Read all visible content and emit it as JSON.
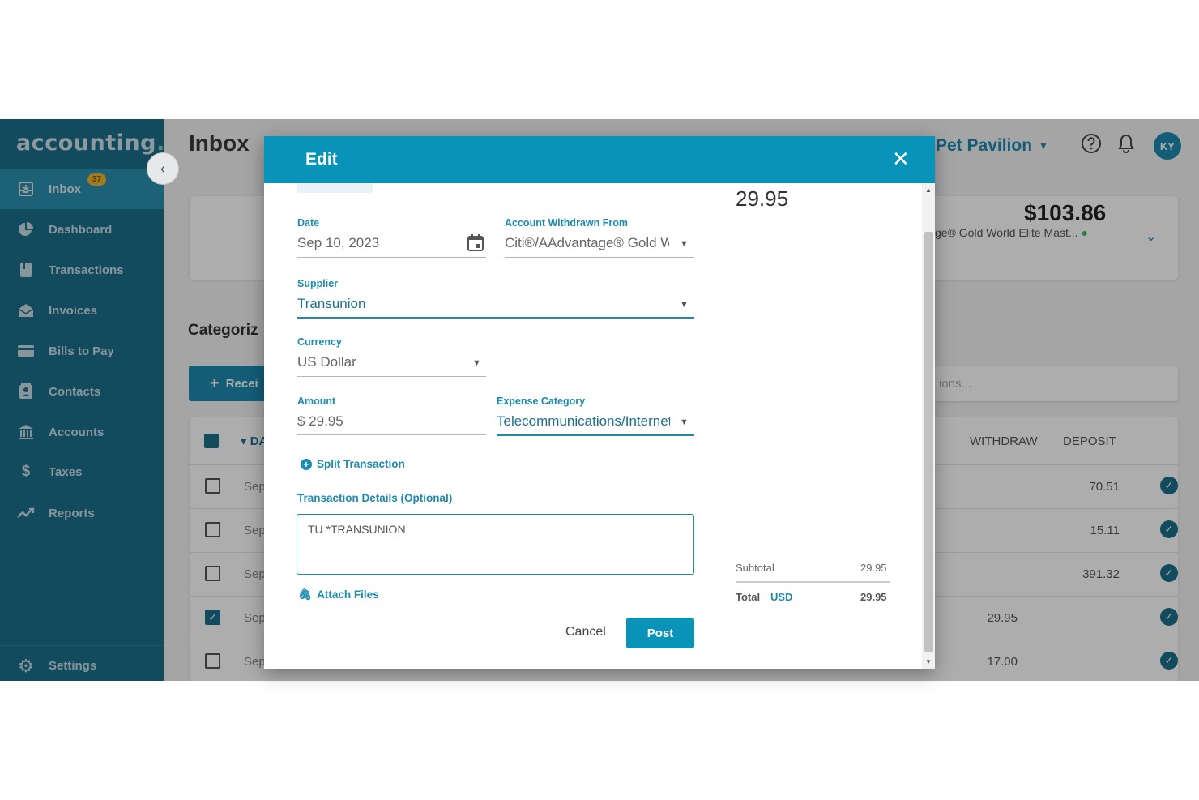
{
  "sidebar": {
    "logo": "accounting",
    "logo_dot": ".",
    "collapse_icon": "chevron-left-icon",
    "items": [
      {
        "label": "Inbox",
        "icon": "inbox-icon",
        "badge": "37",
        "active": true
      },
      {
        "label": "Dashboard",
        "icon": "pie-chart-icon"
      },
      {
        "label": "Transactions",
        "icon": "book-icon"
      },
      {
        "label": "Invoices",
        "icon": "envelope-icon"
      },
      {
        "label": "Bills to Pay",
        "icon": "credit-card-icon"
      },
      {
        "label": "Contacts",
        "icon": "contacts-icon"
      },
      {
        "label": "Accounts",
        "icon": "bank-icon"
      },
      {
        "label": "Taxes",
        "icon": "dollar-icon"
      },
      {
        "label": "Reports",
        "icon": "trend-icon"
      }
    ],
    "settings": {
      "label": "Settings",
      "icon": "gear-icon"
    }
  },
  "header": {
    "title": "Inbox",
    "company": "Pet Pavilion",
    "avatar": "KY",
    "help_icon": "help-icon",
    "bell_icon": "bell-icon"
  },
  "account_card": {
    "balance": "$103.86",
    "account": "ge® Gold World Elite Mast..."
  },
  "categorize": {
    "title": "Categoriz",
    "receipt_button": "Recei",
    "search_placeholder": "ions..."
  },
  "table": {
    "date_header": "DAT",
    "withdraw_header": "WITHDRAW",
    "deposit_header": "DEPOSIT",
    "rows": [
      {
        "date": "Sep",
        "withdraw": "",
        "deposit": "70.51",
        "checked": false
      },
      {
        "date": "Sep",
        "withdraw": "",
        "deposit": "15.11",
        "checked": false
      },
      {
        "date": "Sep",
        "withdraw": "",
        "deposit": "391.32",
        "checked": false
      },
      {
        "date": "Sep",
        "withdraw": "29.95",
        "deposit": "",
        "checked": true
      },
      {
        "date": "Sep",
        "withdraw": "17.00",
        "deposit": "",
        "checked": false
      }
    ]
  },
  "modal": {
    "title": "Edit",
    "close_icon": "close-icon",
    "date_label": "Date",
    "date_value": "Sep 10, 2023",
    "account_label": "Account Withdrawn From",
    "account_value": "Citi®/AAdvantage® Gold World Elite Mast",
    "supplier_label": "Supplier",
    "supplier_value": "Transunion",
    "currency_label": "Currency",
    "currency_value": "US Dollar",
    "amount_label": "Amount",
    "amount_value": "$ 29.95",
    "category_label": "Expense Category",
    "category_value": "Telecommunications/Internet",
    "split_label": "Split Transaction",
    "details_label": "Transaction Details (Optional)",
    "details_value": "TU *TRANSUNION",
    "attach_label": "Attach Files",
    "cancel_label": "Cancel",
    "post_label": "Post",
    "summary": {
      "amount": "29.95",
      "subtotal_label": "Subtotal",
      "subtotal_value": "29.95",
      "total_label": "Total",
      "total_currency": "USD",
      "total_value": "29.95"
    }
  }
}
